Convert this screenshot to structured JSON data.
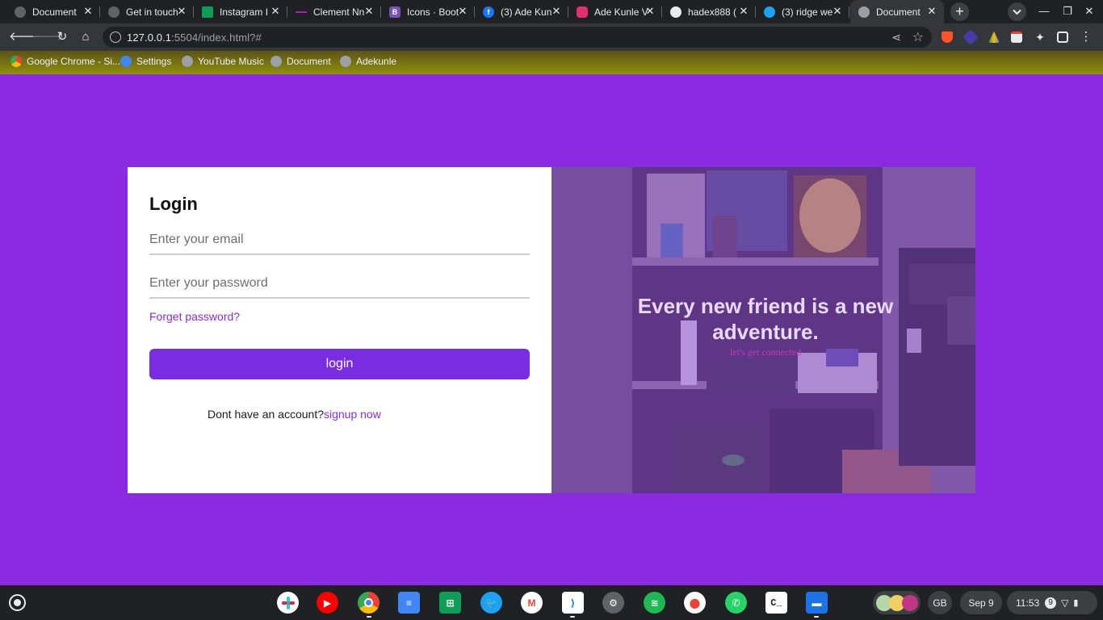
{
  "browser": {
    "tabs": [
      {
        "title": "Document",
        "icon": "globe-icon",
        "color": "#5f6368"
      },
      {
        "title": "Get in touch",
        "icon": "globe-icon",
        "color": "#5f6368"
      },
      {
        "title": "Instagram I",
        "icon": "sheets-icon",
        "color": "#0f9d58"
      },
      {
        "title": "Clement Nn",
        "icon": "dash-icon",
        "color": "#9c27b0"
      },
      {
        "title": "Icons · Boot",
        "icon": "bootstrap-icon",
        "color": "#7952b3"
      },
      {
        "title": "(3) Ade Kun",
        "icon": "facebook-icon",
        "color": "#1877f2"
      },
      {
        "title": "Ade Kunle V",
        "icon": "instagram-icon",
        "color": "#e1306c"
      },
      {
        "title": "hadex888 (",
        "icon": "github-icon",
        "color": "#e8eaed"
      },
      {
        "title": "(3) ridge we",
        "icon": "twitter-icon",
        "color": "#1da1f2"
      },
      {
        "title": "Document",
        "icon": "globe-icon",
        "color": "#9aa0a6"
      }
    ],
    "url_host": "127.0.0.1",
    "url_rest": ":5504/index.html?#",
    "bookmarks": [
      {
        "label": "Google Chrome - Si...",
        "icon": "chrome-icon"
      },
      {
        "label": "Settings",
        "icon": "settings-icon"
      },
      {
        "label": "YouTube Music",
        "icon": "globe-icon"
      },
      {
        "label": "Document",
        "icon": "globe-icon"
      },
      {
        "label": "Adekunle",
        "icon": "globe-icon"
      }
    ]
  },
  "login": {
    "title": "Login",
    "email_placeholder": "Enter your email",
    "password_placeholder": "Enter your password",
    "forget_label": "Forget password?",
    "button_label": "login",
    "signup_prompt": "Dont have an account?",
    "signup_link": "signup now"
  },
  "hero": {
    "headline": "Every new friend is a new adventure.",
    "subline": "let's get connected"
  },
  "shelf": {
    "apps": [
      "slack",
      "youtube",
      "chrome",
      "docs",
      "sheets",
      "twitter",
      "gmail",
      "vscode",
      "settings",
      "spotify",
      "maps",
      "whatsapp",
      "terminal",
      "files"
    ],
    "region": "GB",
    "date": "Sep 9",
    "time": "11:53",
    "notification_count": "9"
  },
  "colors": {
    "page_bg": "#8a2be2",
    "accent": "#7a2ce0",
    "link": "#8a2be2"
  }
}
